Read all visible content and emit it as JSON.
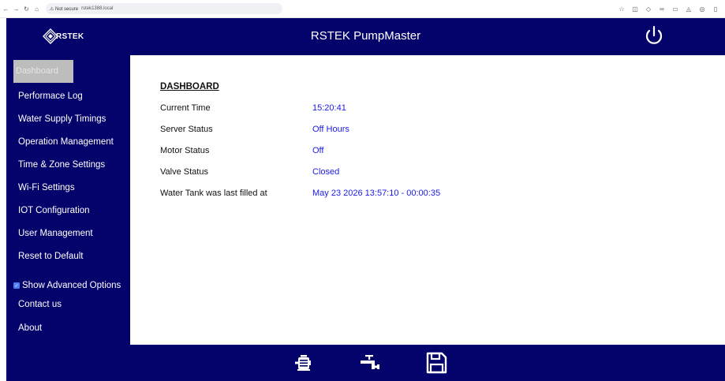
{
  "browser": {
    "url_warning": "⚠ Not secure",
    "url": "rstek1388.local"
  },
  "header": {
    "logo_text": "RSTEK",
    "title": "RSTEK PumpMaster"
  },
  "sidebar": {
    "items": [
      {
        "label": "Dashboard"
      },
      {
        "label": "Performace Log"
      },
      {
        "label": "Water Supply Timings"
      },
      {
        "label": "Operation Management"
      },
      {
        "label": "Time & Zone Settings"
      },
      {
        "label": "Wi-Fi Settings"
      },
      {
        "label": "IOT Configuration"
      },
      {
        "label": "User Management"
      },
      {
        "label": "Reset to Default"
      }
    ],
    "advanced_label": "Show Advanced Options",
    "advanced_checked": true,
    "contact_label": "Contact us",
    "about_label": "About"
  },
  "main": {
    "heading": "DASHBOARD",
    "rows": [
      {
        "label": "Current Time",
        "value": "15:20:41"
      },
      {
        "label": "Server Status",
        "value": "Off Hours"
      },
      {
        "label": "Motor Status",
        "value": "Off"
      },
      {
        "label": "Valve Status",
        "value": "Closed"
      },
      {
        "label": "Water Tank was last filled at",
        "value": "May 23 2026 13:57:10 - 00:00:35"
      }
    ]
  },
  "footer": {
    "icons": [
      "motor-icon",
      "tap-icon",
      "save-icon"
    ]
  },
  "colors": {
    "brand_navy": "#03036b",
    "value_blue": "#1a1ae6",
    "active_item": "#bdbdbd"
  }
}
